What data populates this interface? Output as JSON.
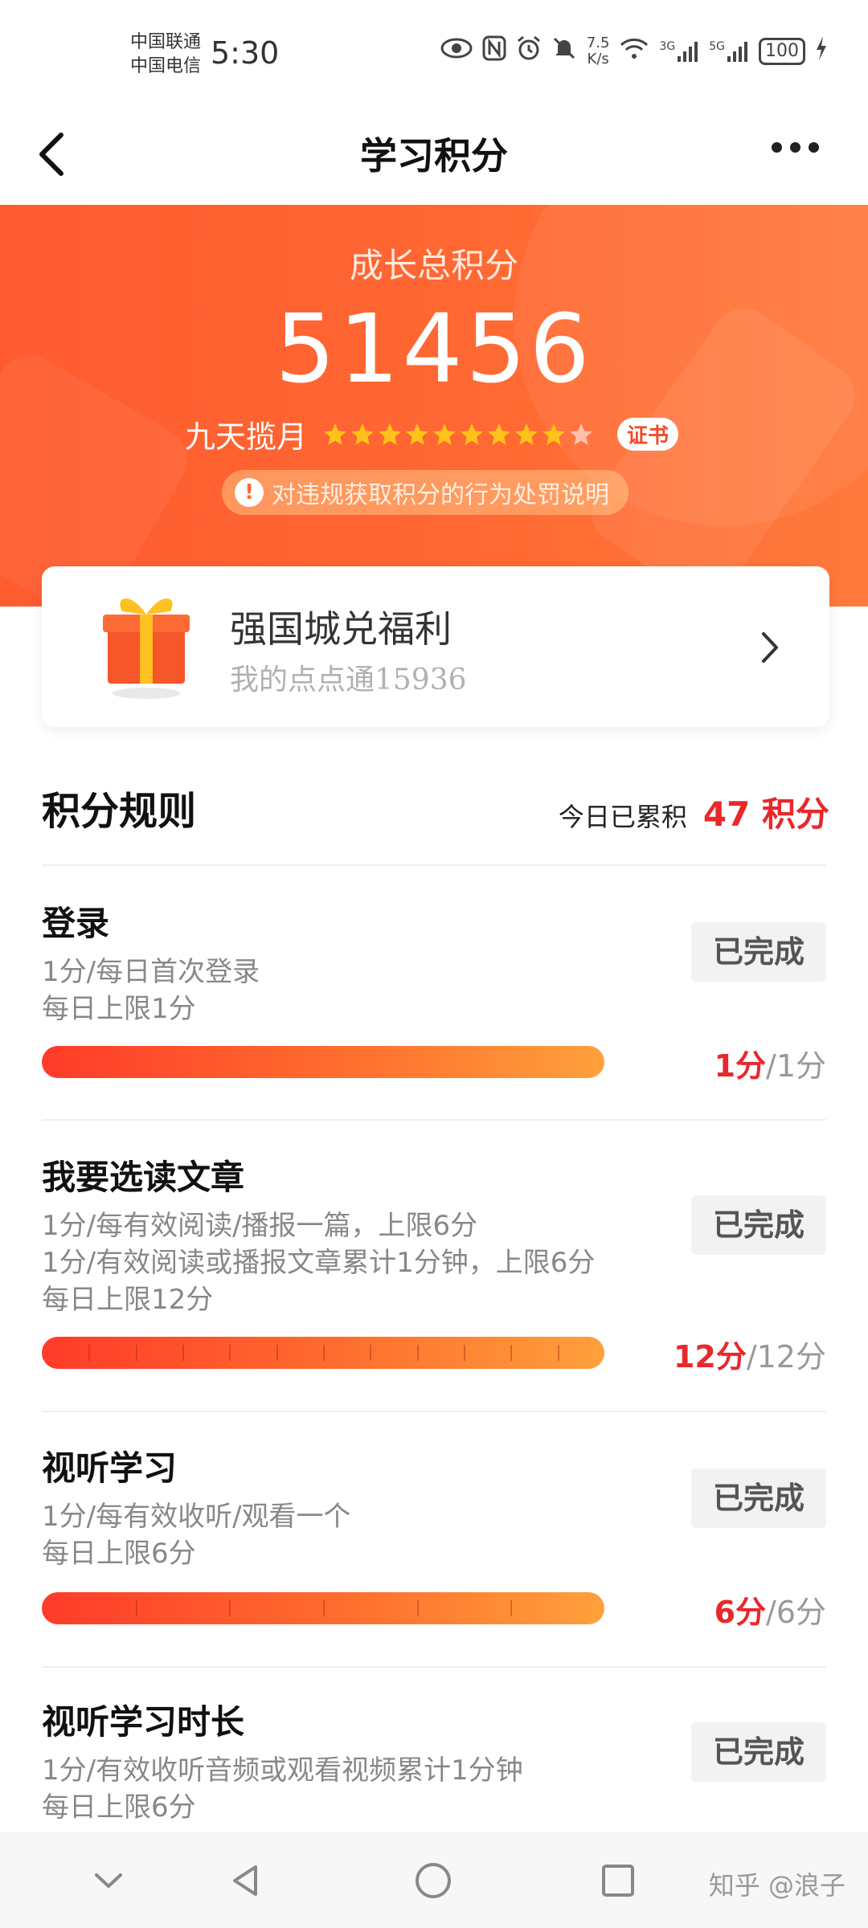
{
  "status_bar": {
    "carrier1": "中国联通",
    "carrier2": "中国电信",
    "time": "5:30",
    "speed_value": "7.5",
    "speed_unit": "K/s",
    "net1": "3G",
    "net2": "5G",
    "battery": "100"
  },
  "nav": {
    "title": "学习积分"
  },
  "hero": {
    "label": "成长总积分",
    "total": "51456",
    "level_name": "九天揽月",
    "stars_filled": 9,
    "stars_total": 10,
    "cert_label": "证书",
    "notice": "对违规获取积分的行为处罚说明"
  },
  "card": {
    "title": "强国城兑福利",
    "subtitle": "我的点点通15936"
  },
  "rules": {
    "title": "积分规则",
    "today_label": "今日已累积",
    "today_value": "47 积分",
    "items": [
      {
        "name": "登录",
        "desc": [
          "1分/每日首次登录",
          "每日上限1分"
        ],
        "status": "已完成",
        "got": "1分",
        "max": "/1分",
        "progress": 1.0,
        "segments": 1
      },
      {
        "name": "我要选读文章",
        "desc": [
          "1分/每有效阅读/播报一篇，上限6分",
          "1分/有效阅读或播报文章累计1分钟，上限6分",
          "每日上限12分"
        ],
        "status": "已完成",
        "got": "12分",
        "max": "/12分",
        "progress": 1.0,
        "segments": 12
      },
      {
        "name": "视听学习",
        "desc": [
          "1分/每有效收听/观看一个",
          "每日上限6分"
        ],
        "status": "已完成",
        "got": "6分",
        "max": "/6分",
        "progress": 1.0,
        "segments": 6
      },
      {
        "name": "视听学习时长",
        "desc": [
          "1分/有效收听音频或观看视频累计1分钟",
          "每日上限6分"
        ],
        "status": "已完成"
      }
    ]
  },
  "watermark": "知乎 @浪子",
  "colors": {
    "accent": "#ff5b2f",
    "score_red": "#e8282b",
    "star": "#ffc21a"
  }
}
